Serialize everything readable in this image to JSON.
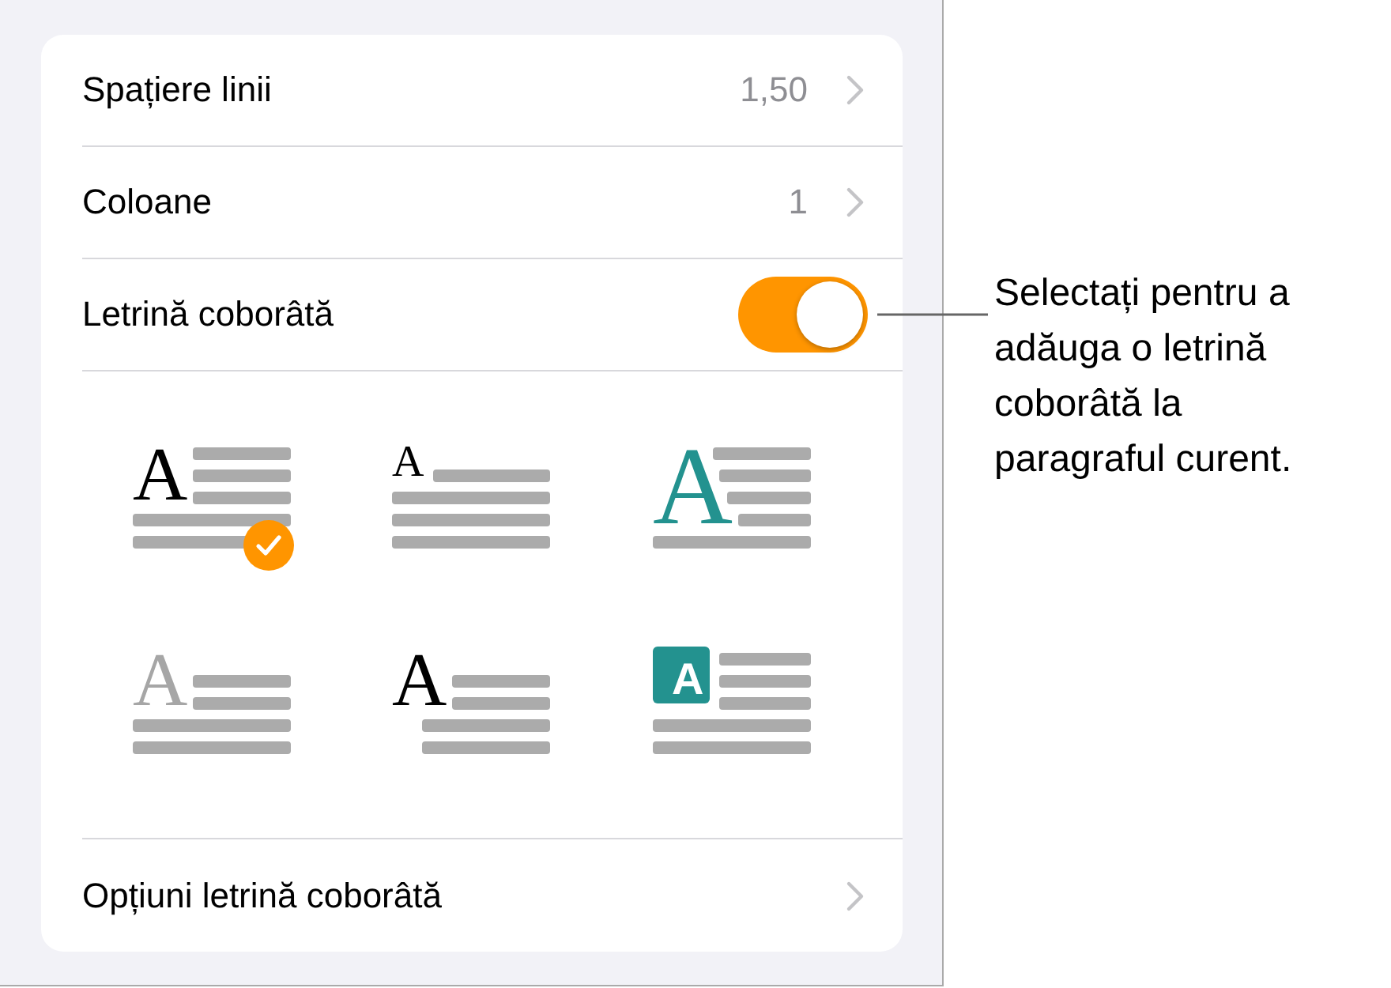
{
  "rows": [
    {
      "kind": "value",
      "label": "Spațiere linii",
      "value": "1,50"
    },
    {
      "kind": "value",
      "label": "Coloane",
      "value": "1"
    },
    {
      "kind": "toggle",
      "label": "Letrină coborâtă",
      "on": true
    }
  ],
  "styles": [
    {
      "kind": "drop",
      "letter": "A",
      "selected": true
    },
    {
      "kind": "raised",
      "letter": "A",
      "selected": false
    },
    {
      "kind": "stepped",
      "letter": "A",
      "selected": false
    },
    {
      "kind": "faded",
      "letter": "A",
      "selected": false
    },
    {
      "kind": "hanging",
      "letter": "A",
      "selected": false
    },
    {
      "kind": "boxed",
      "letter": "A",
      "selected": false
    }
  ],
  "options_row": {
    "label": "Opțiuni letrină coborâtă"
  },
  "callout": "Selectați pentru a adăuga o letrină coborâtă la paragraful curent."
}
